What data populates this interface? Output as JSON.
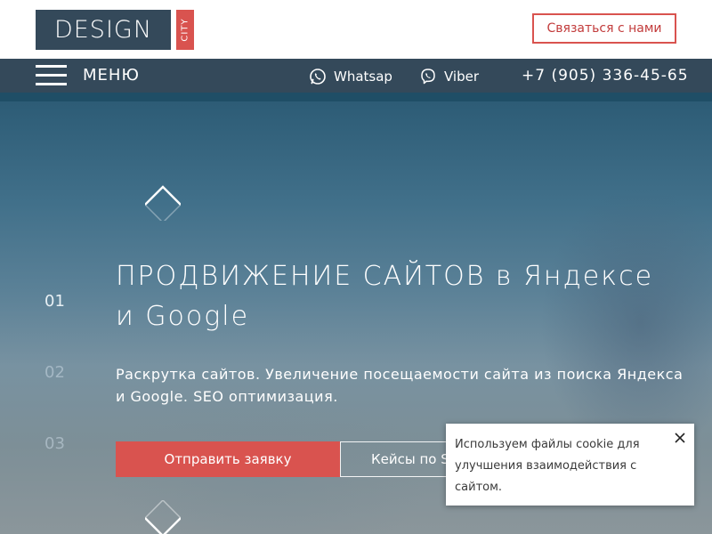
{
  "header": {
    "logo_main": "DESIGN",
    "logo_side": "CITY",
    "contact_button": "Связаться с нами"
  },
  "nav": {
    "menu_label": "МЕНЮ",
    "whatsapp_label": "Whatsap",
    "viber_label": "Viber",
    "phone": "+7 (905) 336-45-65"
  },
  "hero": {
    "title_line1": "ПРОДВИЖЕНИЕ САЙТОВ в Яндексе",
    "title_line2": "и Google",
    "subtitle_line1": "Раскрутка сайтов. Увеличение посещаемости сайта из поиска Яндекса",
    "subtitle_line2": "и Google. SEO оптимизация.",
    "slides": [
      "01",
      "02",
      "03"
    ],
    "primary_button": "Отправить заявку",
    "secondary_button": "Кейсы по SEO"
  },
  "cookie": {
    "line1": "Используем файлы cookie для",
    "line2": "улучшения взаимодействия с",
    "line3": "сайтом."
  },
  "colors": {
    "brand_dark": "#34495a",
    "accent_red": "#d9534f"
  },
  "icons": {
    "menu": "hamburger-icon",
    "whatsapp": "whatsapp-icon",
    "viber": "viber-icon",
    "prev": "chevron-up-icon",
    "next": "chevron-down-icon",
    "close": "close-icon"
  }
}
